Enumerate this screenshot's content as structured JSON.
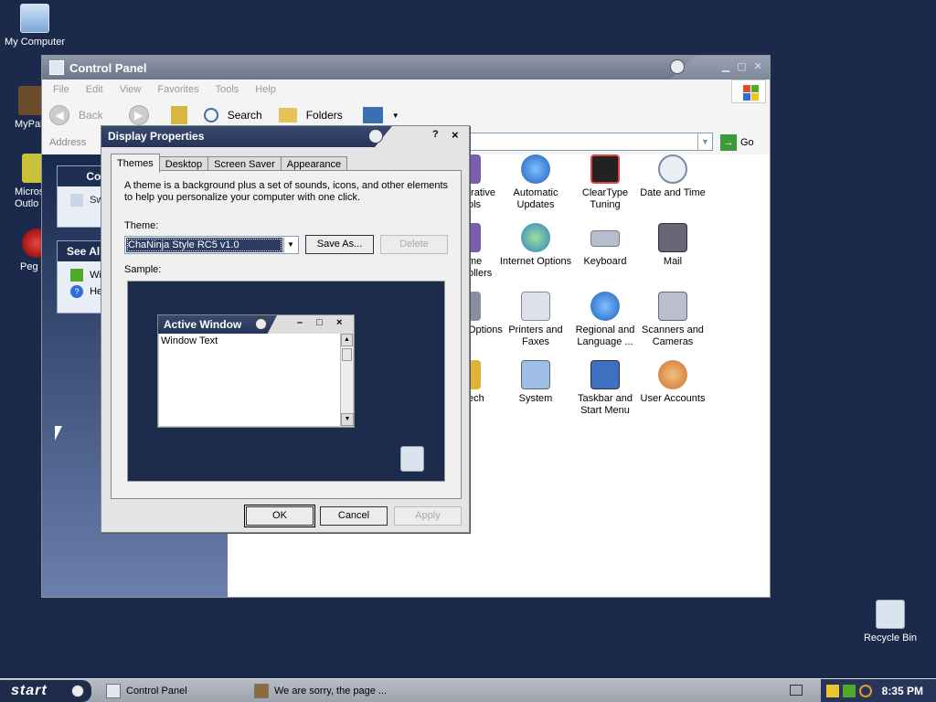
{
  "desktop": {
    "icons": [
      {
        "label": "My Computer"
      },
      {
        "label": "MyPal"
      },
      {
        "label": "Micros"
      },
      {
        "label": "Outlo"
      },
      {
        "label": "Peg"
      },
      {
        "label": "Recycle Bin"
      }
    ]
  },
  "control_panel": {
    "title": "Control Panel",
    "menu": [
      "File",
      "Edit",
      "View",
      "Favorites",
      "Tools",
      "Help"
    ],
    "toolbar": {
      "back": "Back",
      "search": "Search",
      "folders": "Folders"
    },
    "address_label": "Address",
    "go_label": "Go",
    "side": {
      "panel1_title": "Co",
      "panel1_item": "Sw",
      "panel2_title": "See Al",
      "panel2_items": [
        "Wi",
        "He"
      ]
    },
    "items": [
      {
        "label": "trative\nols"
      },
      {
        "label": "Automatic Updates"
      },
      {
        "label": "ClearType Tuning"
      },
      {
        "label": "Date and Time"
      },
      {
        "label": "me\nollers"
      },
      {
        "label": "Internet Options"
      },
      {
        "label": "Keyboard"
      },
      {
        "label": "Mail"
      },
      {
        "label": "Options"
      },
      {
        "label": "Printers and Faxes"
      },
      {
        "label": "Regional and Language ..."
      },
      {
        "label": "Scanners and Cameras"
      },
      {
        "label": "ech"
      },
      {
        "label": "System"
      },
      {
        "label": "Taskbar and Start Menu"
      },
      {
        "label": "User Accounts"
      }
    ]
  },
  "dialog": {
    "title": "Display Properties",
    "help": "?",
    "close": "×",
    "tabs": [
      "Themes",
      "Desktop",
      "Screen Saver",
      "Appearance"
    ],
    "active_tab": "Themes",
    "description": "A theme is a background plus a set of sounds, icons, and other elements to help you personalize your computer with one click.",
    "theme_label": "Theme:",
    "theme_value": "ChaNinja Style RC5 v1.0",
    "save_as": "Save As...",
    "delete": "Delete",
    "sample_label": "Sample:",
    "sample": {
      "window_title": "Active Window",
      "window_text": "Window Text",
      "min": "–",
      "max": "□",
      "close": "×"
    },
    "ok": "OK",
    "cancel": "Cancel",
    "apply": "Apply"
  },
  "taskbar": {
    "start_label": "start",
    "tasks": [
      "Control Panel",
      "We are sorry, the page ..."
    ],
    "clock": "8:35 PM"
  }
}
